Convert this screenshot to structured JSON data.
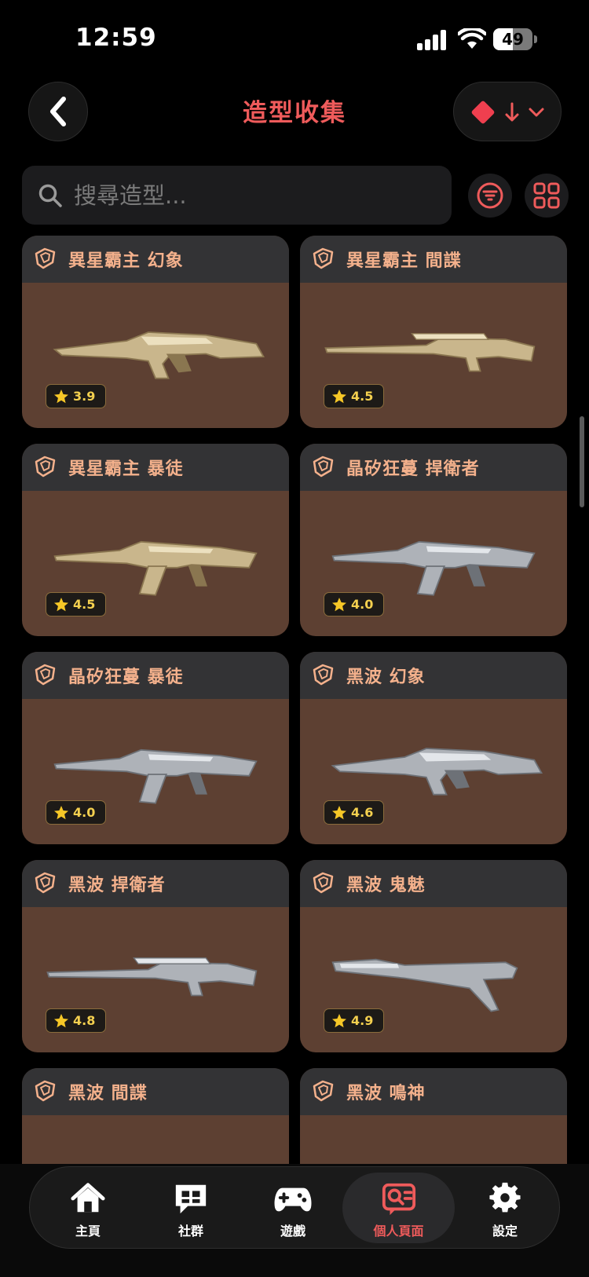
{
  "status_bar": {
    "time": "12:59",
    "battery": "49",
    "battery_level": 0.49
  },
  "header": {
    "title": "造型收集"
  },
  "search": {
    "placeholder": "搜尋造型..."
  },
  "colors": {
    "accent": "#ef5b5b",
    "card_bg": "#5d4032",
    "card_header": "#333335",
    "card_title": "#f4b18c",
    "rating": "#f4d04f"
  },
  "skins": [
    {
      "name": "異星霸主 幻象",
      "rating": "3.9",
      "finish": "gold"
    },
    {
      "name": "異星霸主 間諜",
      "rating": "4.5",
      "finish": "gold"
    },
    {
      "name": "異星霸主 暴徒",
      "rating": "4.5",
      "finish": "gold"
    },
    {
      "name": "晶矽狂蔓 捍衛者",
      "rating": "4.0",
      "finish": "silver"
    },
    {
      "name": "晶矽狂蔓 暴徒",
      "rating": "4.0",
      "finish": "silver"
    },
    {
      "name": "黑波 幻象",
      "rating": "4.6",
      "finish": "silver"
    },
    {
      "name": "黑波 捍衛者",
      "rating": "4.8",
      "finish": "silver"
    },
    {
      "name": "黑波 鬼魅",
      "rating": "4.9",
      "finish": "silver"
    },
    {
      "name": "黑波 間諜",
      "rating": "",
      "finish": "silver"
    },
    {
      "name": "黑波 鳴神",
      "rating": "",
      "finish": "silver"
    }
  ],
  "tabs": [
    {
      "label": "主頁",
      "icon": "home-icon"
    },
    {
      "label": "社群",
      "icon": "chat-icon"
    },
    {
      "label": "遊戲",
      "icon": "gamepad-icon"
    },
    {
      "label": "個人頁面",
      "icon": "profile-search-icon",
      "active": true
    },
    {
      "label": "設定",
      "icon": "gear-icon"
    }
  ]
}
